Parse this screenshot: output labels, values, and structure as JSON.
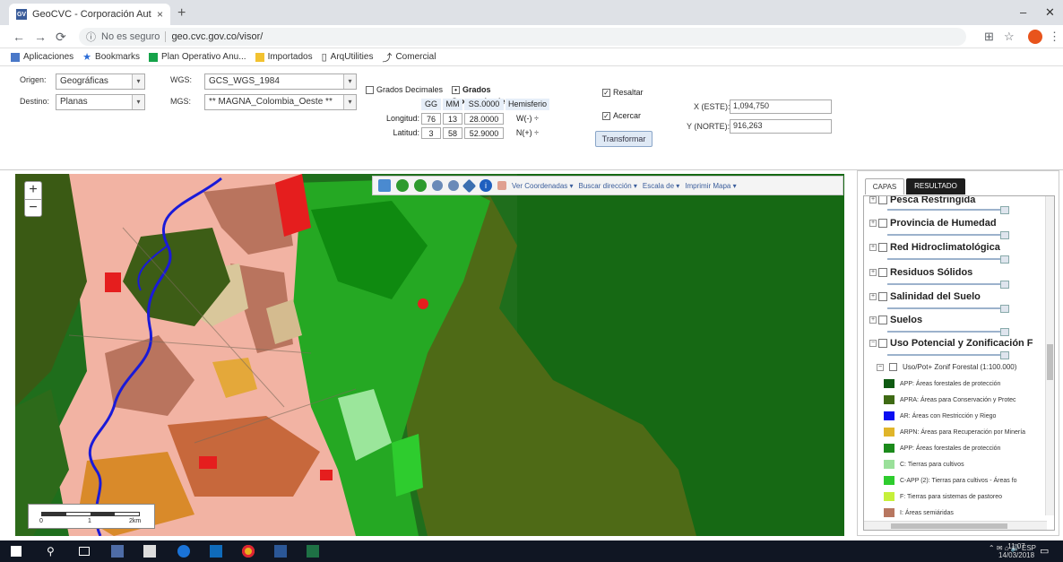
{
  "browser": {
    "tab_title": "GeoCVC - Corporación Autónoma",
    "tab_close": "×",
    "new_tab": "+",
    "address_security": "No es seguro",
    "address_url": "geo.cvc.gov.co/visor/",
    "minimize": "–",
    "close": "✕"
  },
  "bookmarks": [
    {
      "label": "Aplicaciones",
      "color": "#4a78c8"
    },
    {
      "label": "Bookmarks",
      "color": "#2a6bd6"
    },
    {
      "label": "Plan Operativo Anu...",
      "color": "#16a34a"
    },
    {
      "label": "Importados",
      "color": "#f2c230"
    },
    {
      "label": "ArqUtilities",
      "color": "#555555"
    },
    {
      "label": "Comercial",
      "color": "#555555"
    }
  ],
  "form": {
    "origen_label": "Origen:",
    "origen_value": "Geográficas",
    "destino_label": "Destino:",
    "destino_value": "Planas",
    "wgs_label": "WGS:",
    "wgs_value": "GCS_WGS_1984",
    "mgs_label": "MGS:",
    "mgs_value": "** MAGNA_Colombia_Oeste **",
    "grados_decimales": "Grados Decimales",
    "grados_sexagesimales": "Grados Sexagesimales",
    "col_gg": "GG",
    "col_mm": "MM",
    "col_ss": "SS.0000",
    "col_hemisferio": "Hemisferio",
    "longitud_label": "Longitud:",
    "longitud_gg": "76",
    "longitud_mm": "13",
    "longitud_ss": "28.0000",
    "longitud_hem": "W(-) ÷",
    "latitud_label": "Latitud:",
    "latitud_gg": "3",
    "latitud_mm": "58",
    "latitud_ss": "52.9000",
    "latitud_hem": "N(+) ÷",
    "check1_label": "Resaltar",
    "check2_label": "Acercar",
    "transform_button": "Transformar",
    "x_label": "X (ESTE):",
    "x_value": "1,094,750",
    "y_label": "Y (NORTE):",
    "y_value": "916,263"
  },
  "map": {
    "zoom_in": "+",
    "zoom_out": "−",
    "menus": [
      "Ver Coordenadas ▾",
      "Buscar dirección ▾",
      "Escala de ▾",
      "Imprimir Mapa ▾"
    ],
    "scale_start": "0",
    "scale_mid": "1",
    "scale_end": "2km"
  },
  "panel": {
    "tab_capas": "CAPAS",
    "tab_resultado": "RESULTADO",
    "layers": [
      "Pesca Restringida",
      "Provincia de Humedad",
      "Red Hidroclimatológica",
      "Residuos Sólidos",
      "Salinidad del Suelo",
      "Suelos",
      "Uso Potencial y Zonificación F"
    ],
    "sublayer": "Uso/Pot+ Zonif Forestal (1:100.000)",
    "legend": [
      {
        "label": "APP: Áreas forestales de protección",
        "color": "#0e5a12"
      },
      {
        "label": "APRA: Áreas para Conservación y Protec",
        "color": "#3f6a14"
      },
      {
        "label": "AR: Áreas con Restricción y Riego",
        "color": "#0a0ef2"
      },
      {
        "label": "ARPN: Áreas para Recuperación por Minería",
        "color": "#e0b52a"
      },
      {
        "label": "APP: Áreas forestales de protección",
        "color": "#1b8a1b"
      },
      {
        "label": "C: Tierras para cultivos",
        "color": "#9ae09a"
      },
      {
        "label": "C-APP (2): Tierras para cultivos - Áreas fo",
        "color": "#2ecc2e"
      },
      {
        "label": "F: Tierras para sistemas de pastoreo",
        "color": "#c6f03a"
      },
      {
        "label": "I: Áreas semiáridas",
        "color": "#b87760"
      }
    ]
  },
  "taskbar": {
    "tray": "⌃ ✉ ⌂ 🔊 ESP",
    "time": "11:07",
    "date": "14/03/2018"
  }
}
